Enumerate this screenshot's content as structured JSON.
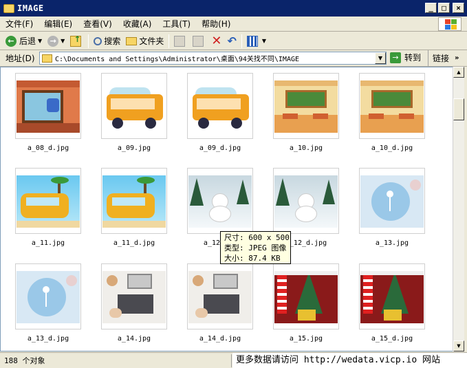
{
  "window": {
    "title": "IMAGE"
  },
  "menu": [
    "文件(F)",
    "编辑(E)",
    "查看(V)",
    "收藏(A)",
    "工具(T)",
    "帮助(H)"
  ],
  "toolbar": {
    "back": "后退",
    "search": "搜索",
    "folders": "文件夹"
  },
  "address": {
    "label": "地址(D)",
    "value": "C:\\Documents and Settings\\Administrator\\桌面\\94关找不同\\IMAGE",
    "go": "转到",
    "links": "链接"
  },
  "files": [
    {
      "name": "a_08_d.jpg",
      "theme": "window"
    },
    {
      "name": "a_09.jpg",
      "theme": "bus"
    },
    {
      "name": "a_09_d.jpg",
      "theme": "bus"
    },
    {
      "name": "a_10.jpg",
      "theme": "classroom"
    },
    {
      "name": "a_10_d.jpg",
      "theme": "classroom"
    },
    {
      "name": "a_11.jpg",
      "theme": "van"
    },
    {
      "name": "a_11_d.jpg",
      "theme": "van"
    },
    {
      "name": "a_12.jpg",
      "theme": "snow"
    },
    {
      "name": "a_12_d.jpg",
      "theme": "snow"
    },
    {
      "name": "a_13.jpg",
      "theme": "winter"
    },
    {
      "name": "a_13_d.jpg",
      "theme": "winter"
    },
    {
      "name": "a_14.jpg",
      "theme": "desk"
    },
    {
      "name": "a_14_d.jpg",
      "theme": "desk"
    },
    {
      "name": "a_15.jpg",
      "theme": "xmas"
    },
    {
      "name": "a_15_d.jpg",
      "theme": "xmas"
    }
  ],
  "tooltip": {
    "size": "尺寸: 600 x 500",
    "type": "类型: JPEG 图像",
    "filesize": "大小: 87.4 KB"
  },
  "status": {
    "count": "188 个对象"
  },
  "watermark": "更多数据请访问 http://wedata.vicp.io 网站"
}
